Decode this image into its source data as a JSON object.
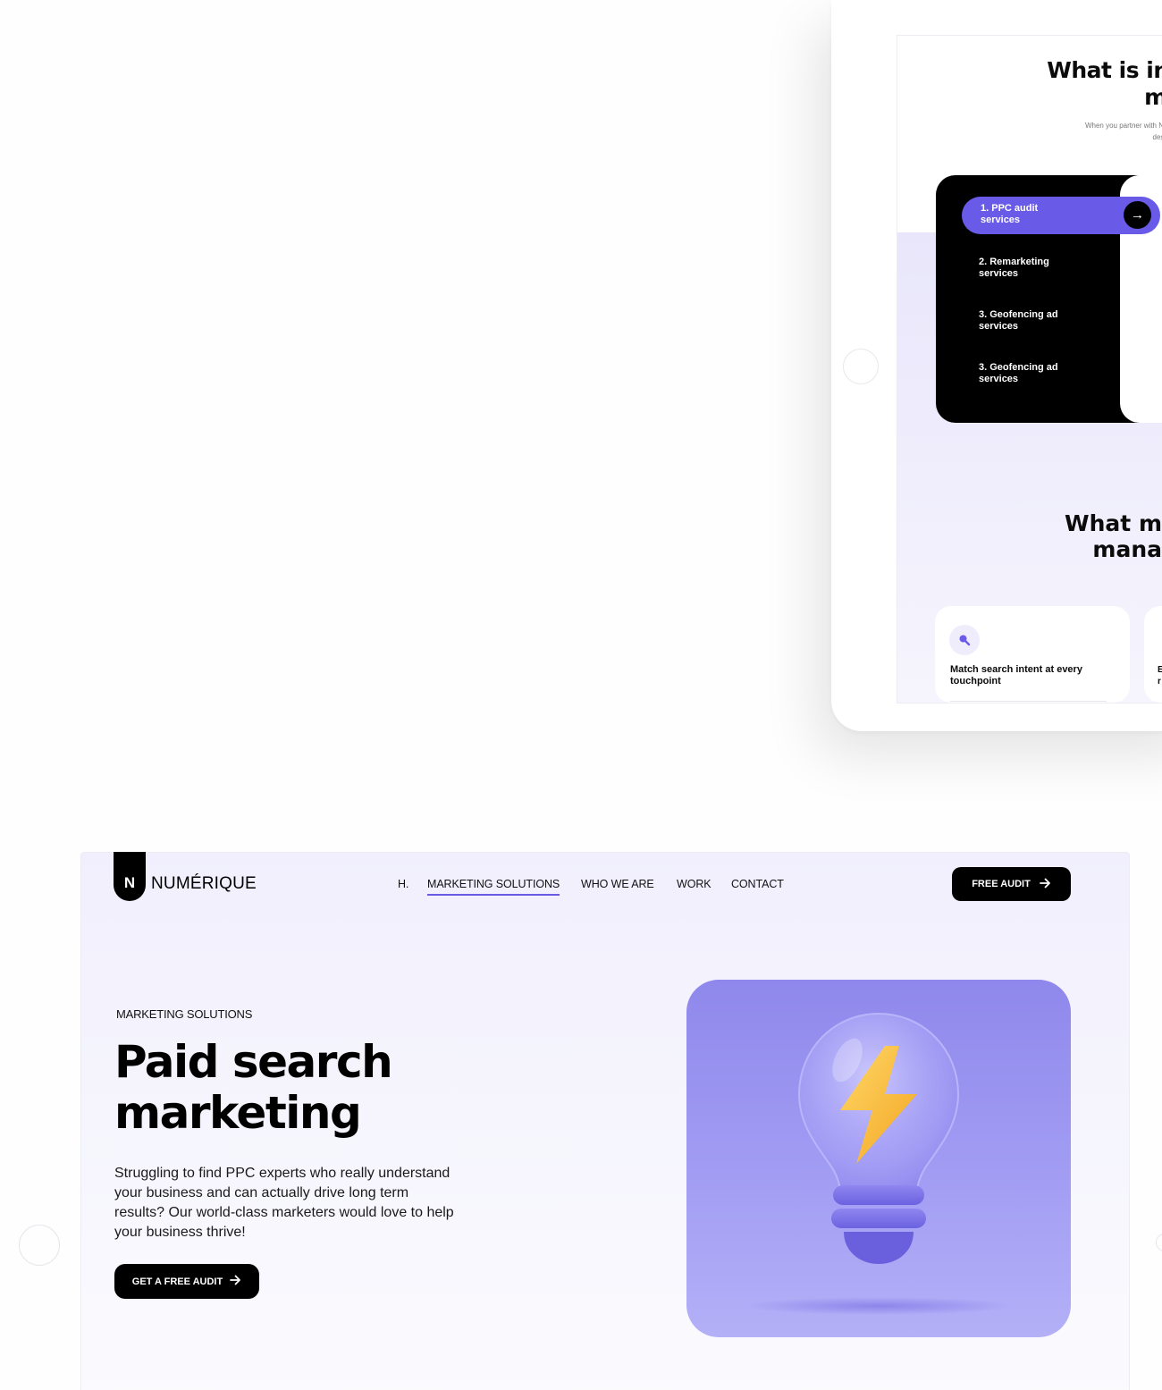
{
  "tablet": {
    "title": "What is inc\nma",
    "subtitle": "When you partner with Numeri\ndesigned",
    "services": [
      {
        "label": "1. PPC audit services",
        "active": true
      },
      {
        "label": "2. Remarketing services",
        "active": false
      },
      {
        "label": "3. Geofencing ad services",
        "active": false
      },
      {
        "label": "3. Geofencing ad services",
        "active": false
      }
    ],
    "section2_title": "What m\nmana",
    "feature": {
      "icon": "search-icon",
      "title": "Match search intent at every touchpoint"
    },
    "feature2_fragments": [
      "E",
      "r"
    ]
  },
  "site": {
    "logo_letter": "N",
    "logo_text": "NUMÉRIQUE",
    "nav": [
      {
        "label": "H.",
        "active": false
      },
      {
        "label": "MARKETING SOLUTIONS",
        "active": true
      },
      {
        "label": "WHO WE ARE",
        "active": false
      },
      {
        "label": "WORK",
        "active": false
      },
      {
        "label": "CONTACT",
        "active": false
      }
    ],
    "header_button": "FREE AUDIT",
    "eyebrow": "MARKETING SOLUTIONS",
    "hero_title": "Paid search\nmarketing",
    "hero_copy": "Struggling to find PPC experts who really understand your business and can actually drive long term results? Our world-class marketers would love to help your business thrive!",
    "cta_button": "GET A FREE AUDIT",
    "hero_image": "lightbulb-lightning-illustration"
  },
  "colors": {
    "accent": "#6a5ae8",
    "dark": "#000000",
    "hero_panel": "#9b95f0",
    "bulb_bolt": "#f5b935"
  }
}
